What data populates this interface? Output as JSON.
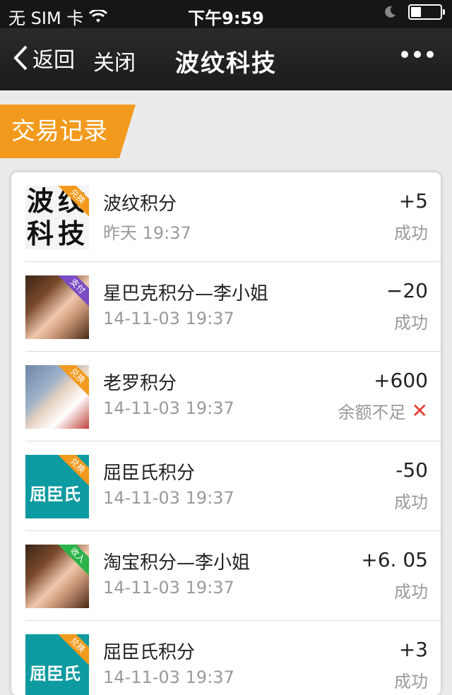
{
  "status_bar": {
    "carrier": "无 SIM 卡",
    "time": "下午9:59"
  },
  "nav": {
    "back_label": "返回",
    "close_label": "关闭",
    "title": "波纹科技"
  },
  "section": {
    "title": "交易记录"
  },
  "transactions": [
    {
      "name": "波纹积分",
      "date": "昨天  19:37",
      "amount": "+5",
      "status": "成功",
      "badge": "兑换",
      "badge_color": "#f29a1d",
      "thumb": "bw"
    },
    {
      "name": "星巴克积分—李小姐",
      "date": "14-11-03  19:37",
      "amount": "−20",
      "status": "成功",
      "badge": "支付",
      "badge_color": "#7a4cc4",
      "thumb": "photo-girl"
    },
    {
      "name": "老罗积分",
      "date": "14-11-03  19:37",
      "amount": "+600",
      "status": "余额不足",
      "badge": "兑换",
      "badge_color": "#f29a1d",
      "thumb": "photo-man",
      "failed": true
    },
    {
      "name": "屈臣氏积分",
      "date": "14-11-03  19:37",
      "amount": "-50",
      "status": "成功",
      "badge": "兑换",
      "badge_color": "#f29a1d",
      "thumb": "teal"
    },
    {
      "name": "淘宝积分—李小姐",
      "date": "14-11-03  19:37",
      "amount": "+6. 05",
      "status": "成功",
      "badge": "收入",
      "badge_color": "#2bb34a",
      "thumb": "photo-girl"
    },
    {
      "name": "屈臣氏积分",
      "date": "14-11-03  19:37",
      "amount": "+3",
      "status": "成功",
      "badge": "兑换",
      "badge_color": "#f29a1d",
      "thumb": "teal"
    }
  ],
  "thumb_text": {
    "bw": [
      "波",
      "纹",
      "科",
      "技"
    ],
    "teal": "屈臣氏"
  },
  "icons": {
    "fail": "close-x-icon"
  }
}
